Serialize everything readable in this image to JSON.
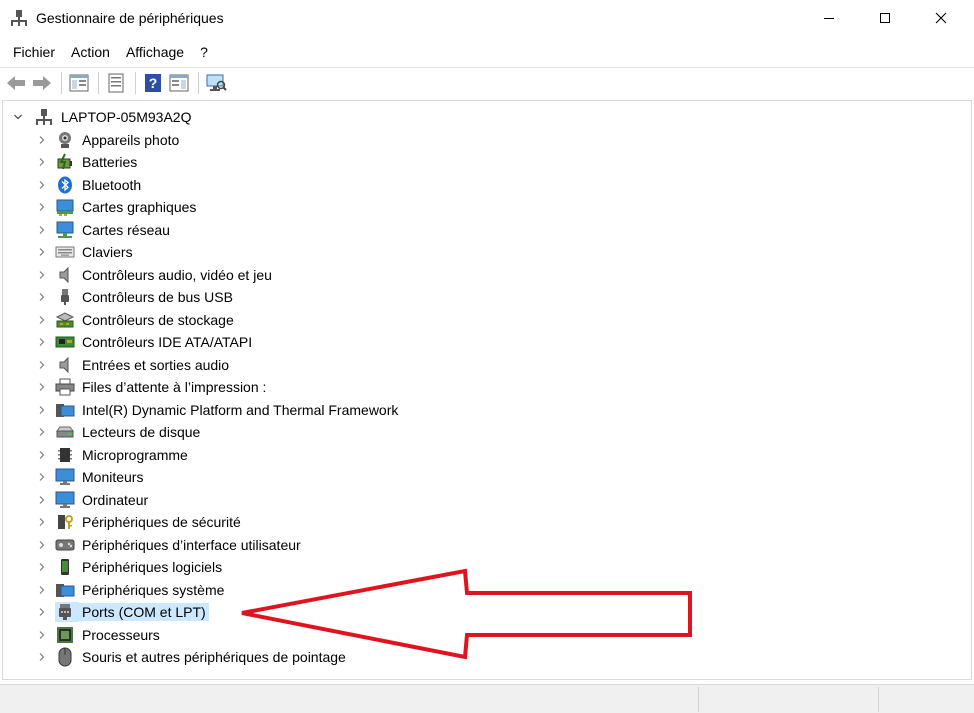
{
  "window": {
    "title": "Gestionnaire de périphériques",
    "icon": "device-manager-icon"
  },
  "menu": [
    {
      "label": "Fichier"
    },
    {
      "label": "Action"
    },
    {
      "label": "Affichage"
    },
    {
      "label": "?"
    }
  ],
  "toolbar": {
    "buttons": [
      "back-arrow-icon",
      "forward-arrow-icon",
      "show-hide-tree-icon",
      "properties-icon",
      "help-icon",
      "action-pane-icon",
      "scan-hardware-icon"
    ]
  },
  "tree": {
    "root": {
      "label": "LAPTOP-05M93A2Q",
      "icon": "computer-network-icon",
      "expanded": true
    },
    "children": [
      {
        "label": "Appareils photo",
        "icon": "camera-icon"
      },
      {
        "label": "Batteries",
        "icon": "battery-icon"
      },
      {
        "label": "Bluetooth",
        "icon": "bluetooth-icon"
      },
      {
        "label": "Cartes graphiques",
        "icon": "display-adapter-icon"
      },
      {
        "label": "Cartes réseau",
        "icon": "network-adapter-icon"
      },
      {
        "label": "Claviers",
        "icon": "keyboard-icon"
      },
      {
        "label": "Contrôleurs audio, vidéo et jeu",
        "icon": "speaker-icon"
      },
      {
        "label": "Contrôleurs de bus USB",
        "icon": "usb-icon"
      },
      {
        "label": "Contrôleurs de stockage",
        "icon": "storage-controller-icon"
      },
      {
        "label": "Contrôleurs IDE ATA/ATAPI",
        "icon": "ide-controller-icon"
      },
      {
        "label": "Entrées et sorties audio",
        "icon": "audio-io-icon"
      },
      {
        "label": "Files d’attente à l’impression :",
        "icon": "printer-icon"
      },
      {
        "label": "Intel(R) Dynamic Platform and Thermal Framework",
        "icon": "system-device-icon"
      },
      {
        "label": "Lecteurs de disque",
        "icon": "disk-drive-icon"
      },
      {
        "label": "Microprogramme",
        "icon": "firmware-chip-icon"
      },
      {
        "label": "Moniteurs",
        "icon": "monitor-icon"
      },
      {
        "label": "Ordinateur",
        "icon": "computer-icon"
      },
      {
        "label": "Périphériques de sécurité",
        "icon": "security-key-icon"
      },
      {
        "label": "Périphériques d’interface utilisateur",
        "icon": "hid-icon"
      },
      {
        "label": "Périphériques logiciels",
        "icon": "software-device-icon"
      },
      {
        "label": "Périphériques système",
        "icon": "system-folder-icon"
      },
      {
        "label": "Ports (COM et LPT)",
        "icon": "port-connector-icon",
        "selected": true
      },
      {
        "label": "Processeurs",
        "icon": "processor-icon"
      },
      {
        "label": "Souris et autres périphériques de pointage",
        "icon": "mouse-icon"
      }
    ]
  },
  "colors": {
    "selection": "#cce8ff",
    "annotation_arrow": "#e0141e"
  }
}
